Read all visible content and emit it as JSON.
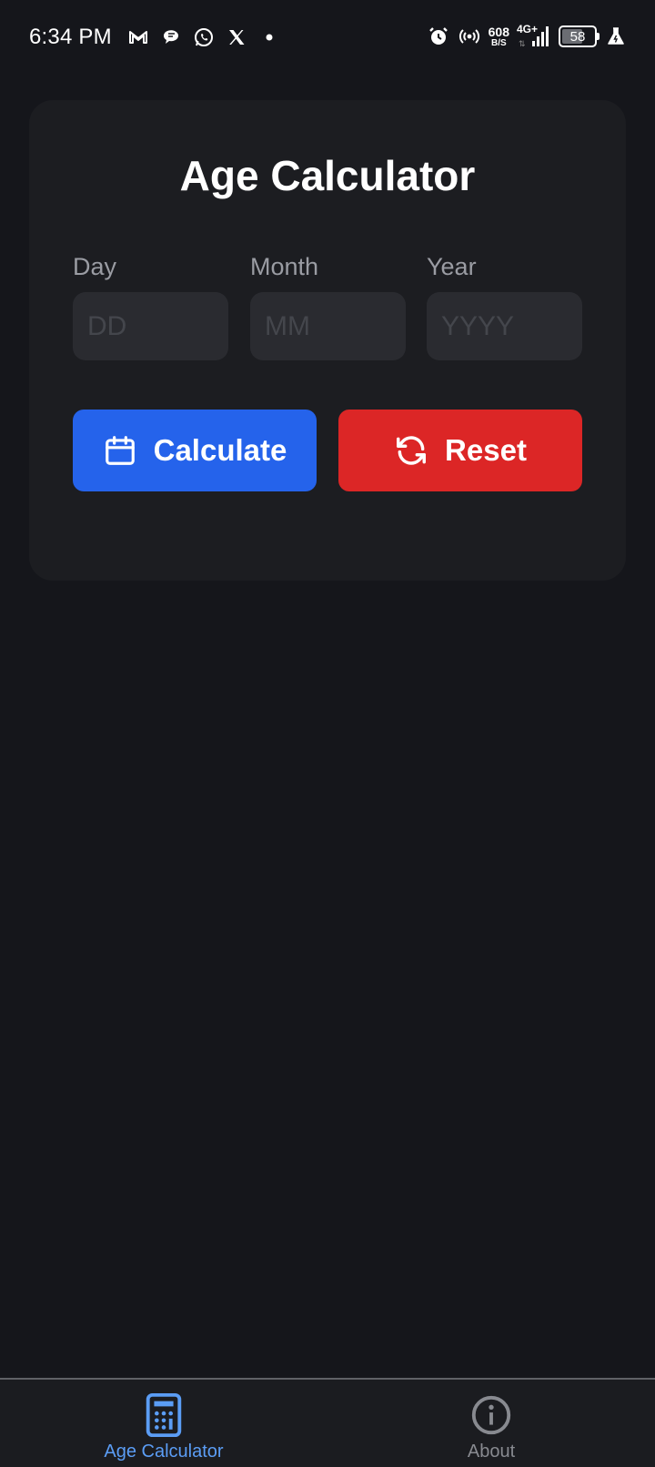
{
  "status_bar": {
    "time": "6:34 PM",
    "notification_icons": [
      "gmail-icon",
      "chat-bubble-icon",
      "whatsapp-icon",
      "x-icon",
      "dot-icon"
    ],
    "net_speed_value": "608",
    "net_speed_unit": "B/S",
    "network_type": "4G+",
    "battery_level": "58",
    "system_icons": [
      "alarm-icon",
      "hotspot-icon",
      "signal-icon",
      "battery-icon",
      "flask-icon"
    ]
  },
  "card": {
    "title": "Age Calculator",
    "fields": [
      {
        "label": "Day",
        "placeholder": "DD",
        "value": ""
      },
      {
        "label": "Month",
        "placeholder": "MM",
        "value": ""
      },
      {
        "label": "Year",
        "placeholder": "YYYY",
        "value": ""
      }
    ],
    "buttons": {
      "calculate_label": "Calculate",
      "reset_label": "Reset"
    }
  },
  "bottom_nav": {
    "items": [
      {
        "label": "Age Calculator",
        "icon": "calculator-icon",
        "active": true
      },
      {
        "label": "About",
        "icon": "info-icon",
        "active": false
      }
    ]
  },
  "colors": {
    "background": "#15161b",
    "card": "#1c1d21",
    "input": "#2a2b30",
    "calculate_button": "#2563eb",
    "reset_button": "#dc2626",
    "nav_active": "#5b9df5",
    "nav_inactive": "#888a90"
  }
}
